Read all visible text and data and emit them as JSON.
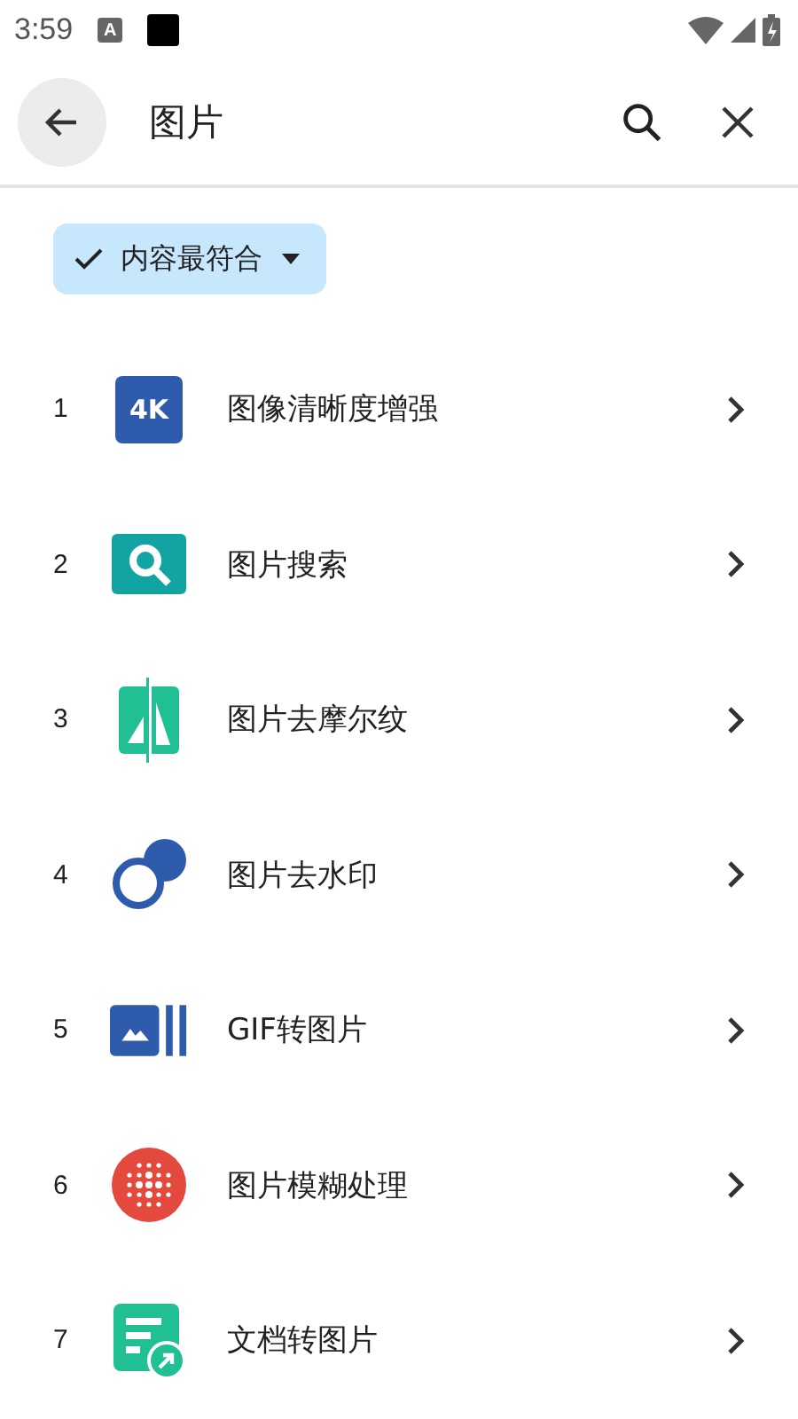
{
  "status_bar": {
    "time": "3:59",
    "app_badge": "A"
  },
  "search_bar": {
    "value": "图片"
  },
  "filter_chip": {
    "label": "内容最符合",
    "selected": true
  },
  "results": [
    {
      "rank": "1",
      "title": "图像清晰度增强",
      "kind": "hd",
      "icon_text": "4K"
    },
    {
      "rank": "2",
      "title": "图片搜索",
      "kind": "search"
    },
    {
      "rank": "3",
      "title": "图片去摩尔纹",
      "kind": "moire"
    },
    {
      "rank": "4",
      "title": "图片去水印",
      "kind": "watermark"
    },
    {
      "rank": "5",
      "title": "GIF转图片",
      "kind": "gif"
    },
    {
      "rank": "6",
      "title": "图片模糊处理",
      "kind": "blur"
    },
    {
      "rank": "7",
      "title": "文档转图片",
      "kind": "doc"
    }
  ]
}
